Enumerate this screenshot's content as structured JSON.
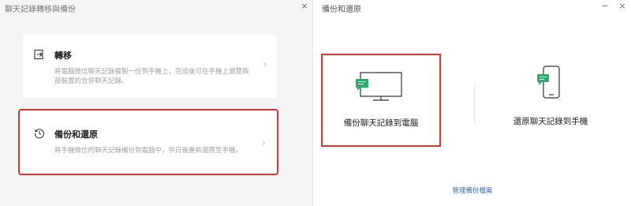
{
  "left_window": {
    "title": "聊天記錄轉移與備份",
    "close": "×",
    "transfer_card": {
      "title": "轉移",
      "description": "將電腦微信聊天記錄複製一份到手機上，完成後可在手機上瀏覽兩部裝置的合併聊天記錄。",
      "chevron": "›"
    },
    "backup_card": {
      "title": "備份和還原",
      "description": "將手機微信的聊天記錄備份到電腦中，供日後重新還原至手機。",
      "chevron": "›"
    }
  },
  "right_window": {
    "title": "備份和還原",
    "minimize": "−",
    "close": "×",
    "backup_to_pc": {
      "label": "備份聊天記錄到電腦"
    },
    "restore_to_phone": {
      "label": "還原聊天記錄到手機"
    },
    "manage_link": "管理備份檔案"
  },
  "colors": {
    "highlight": "#e0352f",
    "accent_green": "#2aae67",
    "link": "#2f6fbf"
  }
}
